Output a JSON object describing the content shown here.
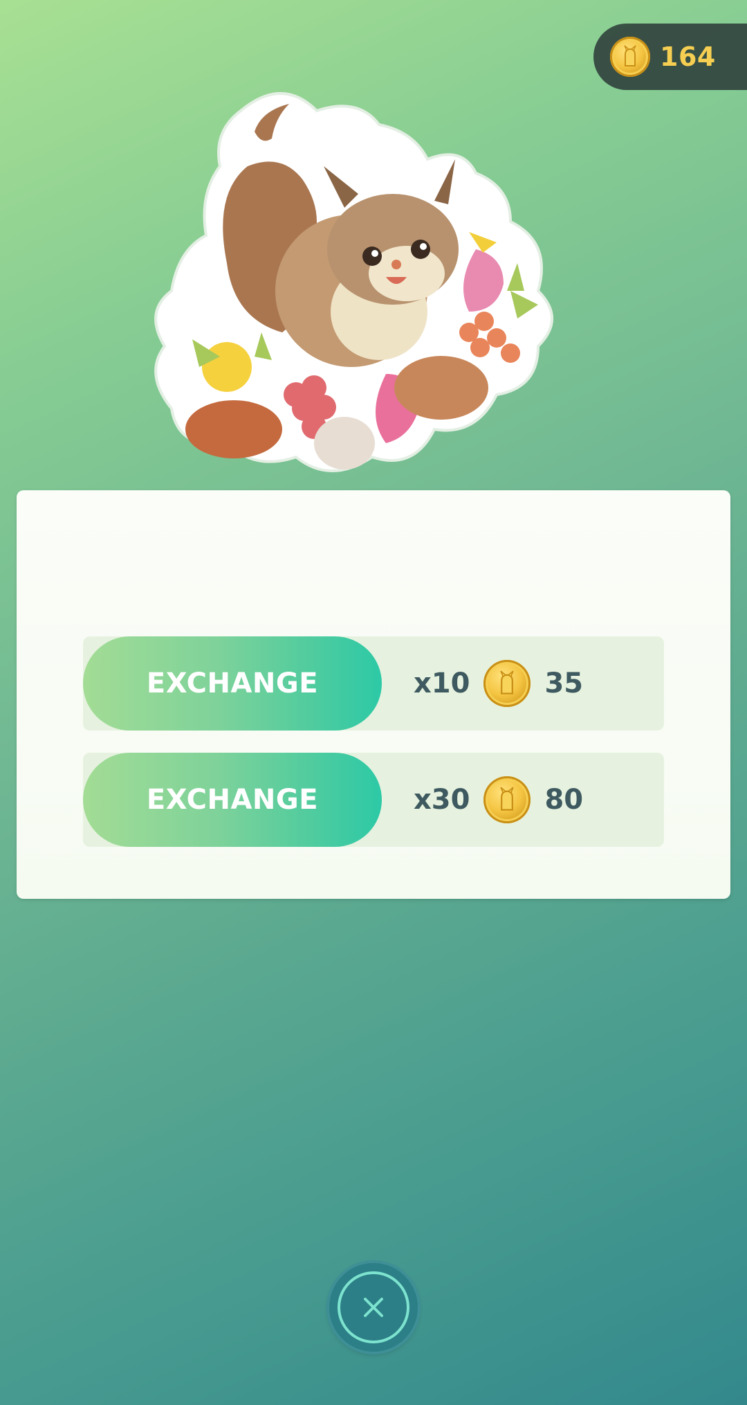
{
  "header": {
    "coin_count": "164",
    "coin_icon": "coin-icon"
  },
  "sticker": {
    "icon": "sticker-illustration"
  },
  "offers": [
    {
      "button_label": "EXCHANGE",
      "quantity": "x10",
      "price": "35",
      "currency_icon": "coin-icon"
    },
    {
      "button_label": "EXCHANGE",
      "quantity": "x30",
      "price": "80",
      "currency_icon": "coin-icon"
    }
  ],
  "close": {
    "icon": "close-icon"
  },
  "colors": {
    "accent_green": "#2dc9a6",
    "coin_gold": "#f4c542",
    "text_dark": "#3e5a60"
  }
}
